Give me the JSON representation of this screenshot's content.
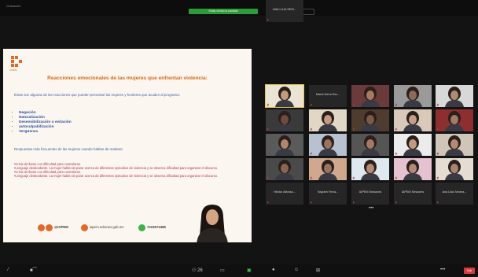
{
  "window": {
    "left_label": "Grabación",
    "center_label": "Estás viendo la pantalla",
    "right_label": "Opciones de vista"
  },
  "slide": {
    "logo_text": "IAPEM",
    "title": "Reacciones emocionales de las mujeres que enfrentan violencia:",
    "intro": "Éstas son algunas de las reacciones que pueden presentar las mujeres y hombres que acuden al programa:",
    "reactions": [
      "Negación",
      "Naturalización",
      "Desensibilización o evitación",
      "autoculpabilización",
      "Vergüenza"
    ],
    "responses_heading": "Respuestas más frecuentes de las mujeres cuando hablan de maltrato:",
    "responses": [
      "•Crisis de llanto con dificultad para controlarse.",
      "•Lenguaje desbordante. La mujer habla sin parar acerca de diferentes episodios de violencia y se observa dificultad para organizar el discurso.",
      "•Crisis de llanto con dificultad para controlarse.",
      "•Lenguaje desbordante. La mujer habla sin parar acerca de diferentes episodios de violencia y se observa dificultad para organizar el discurso."
    ],
    "footer": {
      "social": "@IAPEM",
      "email": "iapem.edomex.gob.mx",
      "phone": "7223574485"
    }
  },
  "gallery": {
    "tiles": [
      {
        "label": "",
        "name": "",
        "skin": "#c79a7e",
        "bg": "#e9e4d4",
        "active": true
      },
      {
        "label": "",
        "name": "María Dena Esc...",
        "skin": "",
        "bg": "",
        "active": false
      },
      {
        "label": "",
        "name": "",
        "skin": "#a87a62",
        "bg": "#6b3a3a",
        "active": false
      },
      {
        "label": "",
        "name": "",
        "skin": "#8c6b5a",
        "bg": "#9a9a9a",
        "active": false
      },
      {
        "label": "",
        "name": "",
        "skin": "#b08a72",
        "bg": "#d8d8d8",
        "active": false
      },
      {
        "label": "",
        "name": "",
        "skin": "#6e4d3e",
        "bg": "#3a3a3a",
        "active": false
      },
      {
        "label": "",
        "name": "",
        "skin": "#c59a82",
        "bg": "#e0d7c4",
        "active": false
      },
      {
        "label": "",
        "name": "",
        "skin": "#7c5a48",
        "bg": "#4e3c30",
        "active": false
      },
      {
        "label": "",
        "name": "",
        "skin": "#c69d86",
        "bg": "#d9c9b8",
        "active": false
      },
      {
        "label": "",
        "name": "",
        "skin": "#a27a68",
        "bg": "#8e2e2e",
        "active": false
      },
      {
        "label": "",
        "name": "",
        "skin": "#b08670",
        "bg": "#5a5a5a",
        "active": false
      },
      {
        "label": "",
        "name": "",
        "skin": "#9a7260",
        "bg": "#b7c1cf",
        "active": false
      },
      {
        "label": "",
        "name": "",
        "skin": "#a37966",
        "bg": "#555555",
        "active": false
      },
      {
        "label": "",
        "name": "",
        "skin": "#c29a83",
        "bg": "#ececec",
        "active": false
      },
      {
        "label": "",
        "name": "",
        "skin": "#b58a75",
        "bg": "#cfc5b9",
        "active": false
      },
      {
        "label": "",
        "name": "",
        "skin": "#8a6554",
        "bg": "#4a4a4a",
        "active": false
      },
      {
        "label": "",
        "name": "",
        "skin": "#9b7361",
        "bg": "#cfa88e",
        "active": false
      },
      {
        "label": "",
        "name": "",
        "skin": "#b58b74",
        "bg": "#dfe7ef",
        "active": false
      },
      {
        "label": "",
        "name": "",
        "skin": "#b08a76",
        "bg": "#e6c1cf",
        "active": false
      },
      {
        "label": "",
        "name": "",
        "skin": "#a98470",
        "bg": "#e5ddd1",
        "active": false
      },
      {
        "label": "",
        "name": "Héctor Alfonso...",
        "skin": "",
        "bg": "",
        "active": false
      },
      {
        "label": "",
        "name": "Hayden Ferra...",
        "skin": "",
        "bg": "",
        "active": false
      },
      {
        "label": "",
        "name": "IAPEM Sesiones",
        "skin": "",
        "bg": "",
        "active": false
      },
      {
        "label": "",
        "name": "IAPEM Sesiones",
        "skin": "",
        "bg": "",
        "active": false
      },
      {
        "label": "",
        "name": "Ana Lilia Senera...",
        "skin": "",
        "bg": "",
        "active": false
      },
      {
        "label": "",
        "name": "ANA LILIA SEIS...",
        "skin": "",
        "bg": "",
        "active": false
      }
    ],
    "more_label": "•••"
  },
  "toolbar": {
    "left1": "⁄",
    "left2": "■⁀",
    "participants": "⚇ 26",
    "chat": "▭",
    "share": "▣",
    "record": "●",
    "reactions": "☺",
    "apps": "⊞",
    "more": "•••",
    "end": "Salir"
  }
}
